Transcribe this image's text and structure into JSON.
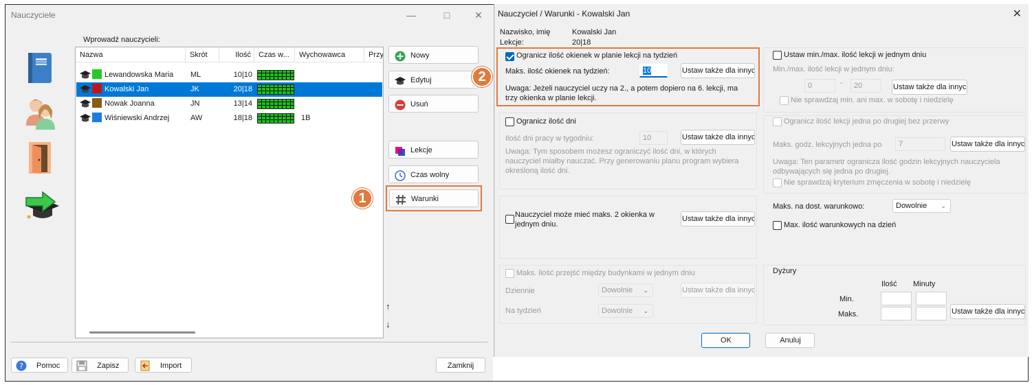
{
  "left_window": {
    "title": "Nauczyciele",
    "list_label": "Wprowadź nauczycieli:",
    "columns": [
      "Nazwa",
      "Skrót",
      "Ilość",
      "Czas w...",
      "Wychowawca",
      "Przy"
    ],
    "rows": [
      {
        "name": "Lewandowska Maria",
        "abbr": "ML",
        "count": "10|10",
        "class": "",
        "color": "#22cc22",
        "selected": false
      },
      {
        "name": "Kowalski Jan",
        "abbr": "JK",
        "count": "20|18",
        "class": "",
        "color": "#c0161b",
        "selected": true
      },
      {
        "name": "Nowak Joanna",
        "abbr": "JN",
        "count": "13|14",
        "class": "",
        "color": "#8b5a14",
        "selected": false
      },
      {
        "name": "Wiśniewski Andrzej",
        "abbr": "AW",
        "count": "18|18",
        "class": "1B",
        "color": "#1e7be6",
        "selected": false
      }
    ],
    "buttons": {
      "new": "Nowy",
      "edit": "Edytuj",
      "delete": "Usuń",
      "lessons": "Lekcje",
      "free_time": "Czas wolny",
      "conditions": "Warunki"
    },
    "footer": {
      "help": "Pomoc",
      "save": "Zapisz",
      "import": "Import",
      "close": "Zamknij"
    },
    "arrows": {
      "up": "↑",
      "down": "↓"
    },
    "badge_1": "1"
  },
  "right_window": {
    "title": "Nauczyciel / Warunki - Kowalski Jan",
    "name_label": "Nazwisko, imię",
    "name_value": "Kowalski Jan",
    "lessons_label": "Lekcje:",
    "lessons_value": "20|18",
    "badge_2": "2",
    "gaps": {
      "checkbox": "Ogranicz ilość okienek w planie lekcji na tydzień",
      "checked": true,
      "max_label": "Maks. ilość okienek na tydzień:",
      "max_value": "10",
      "apply": "Ustaw także dla innych",
      "note": "Uwaga: Jeżeli nauczyciel uczy na 2., a potem dopiero na 6. lekcji, ma trzy okienka w planie lekcji."
    },
    "days": {
      "checkbox": "Ogranicz ilość dni",
      "label": "Ilość dni pracy w tygodniu:",
      "value": "10",
      "apply": "Ustaw także dla innych",
      "note": "Uwaga: Tym sposobem możesz ograniczyć ilość dni, w których nauczyciel miałby nauczać. Przy generowaniu planu program wybiera określoną ilość dni."
    },
    "two_gaps": {
      "checkbox": "Nauczyciel może mieć maks. 2 okienka w jednym dniu.",
      "apply": "Ustaw także dla innych"
    },
    "buildings": {
      "checkbox": "Maks. ilość przejść między budynkami w jednym dniu",
      "daily_label": "Dziennie",
      "daily_value": "Dowolnie",
      "weekly_label": "Na tydzień",
      "weekly_value": "Dowolnie",
      "apply": "Ustaw także dla innych"
    },
    "minmax": {
      "checkbox": "Ustaw min./max. ilość lekcji w jednym dniu",
      "label": "Min./max. ilość lekcji w jednym dniu:",
      "min_value": "0",
      "dash": "-",
      "max_value": "20",
      "apply": "Ustaw także dla innych",
      "weekend": "Nie sprawdzaj min. ani max. w sobotę i niedzielę"
    },
    "consecutive": {
      "checkbox": "Ogranicz ilość lekcji jedna po drugiej bez przerwy",
      "label": "Maks. godz. lekcyjnych jedna po",
      "value": "7",
      "apply": "Ustaw także dla innych",
      "note": "Uwaga: Ten parametr ogranicza ilość godzin lekcyjnych nauczyciela odbywających się jedna po drugiej.",
      "weekend": "Nie sprawdzaj kryterium zmęczenia w sobotę i niedzielę"
    },
    "conditional": {
      "label": "Maks. na dost. warunkowo:",
      "value": "Dowolnie",
      "checkbox": "Max. ilość warunkowych na dzień"
    },
    "duty": {
      "title": "Dyżury",
      "col_count": "Ilość",
      "col_minutes": "Minuty",
      "min_label": "Min.",
      "max_label": "Maks.",
      "apply": "Ustaw także dla innych"
    },
    "ok": "OK",
    "cancel": "Anuluj"
  }
}
